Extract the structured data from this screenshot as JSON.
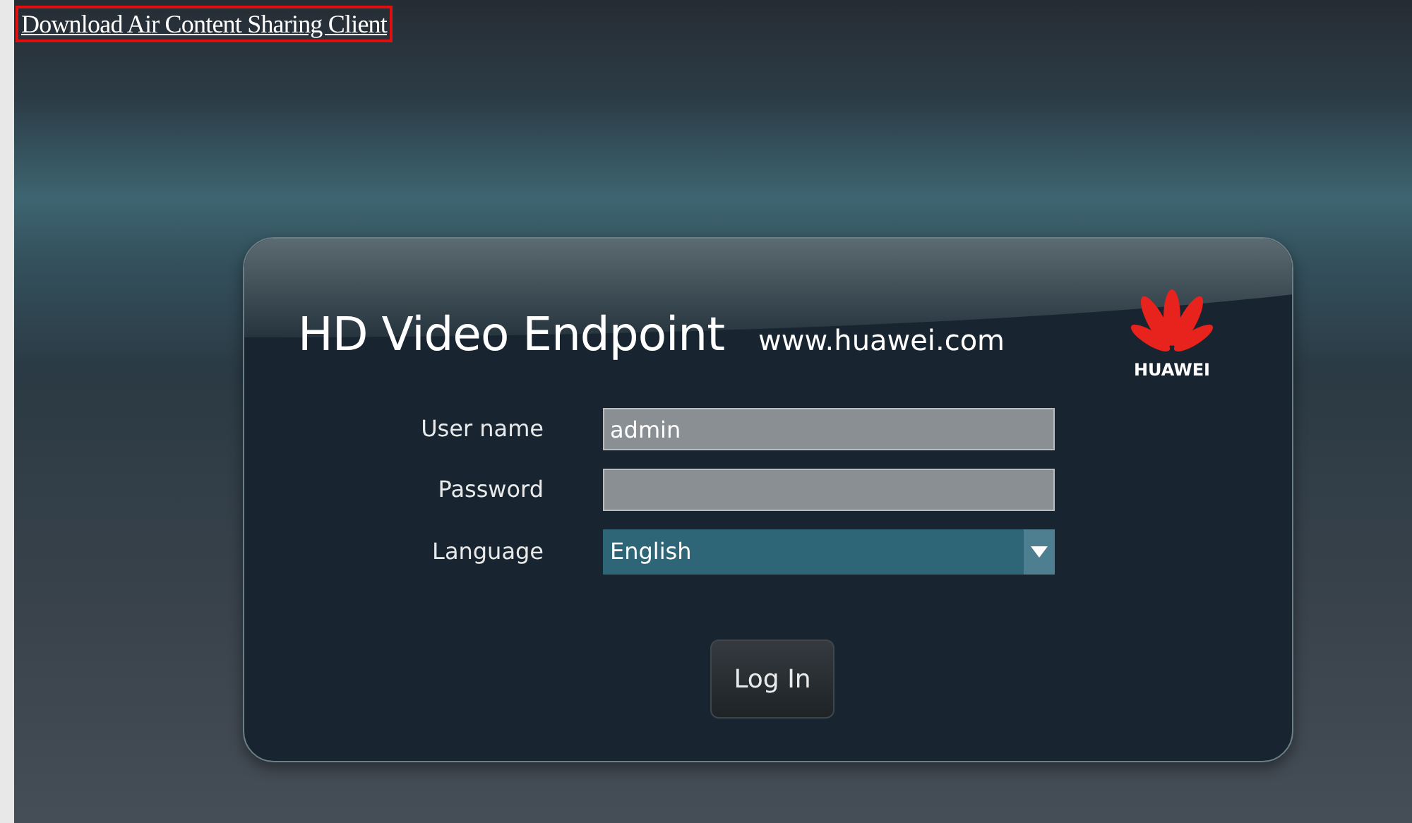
{
  "download_link": "Download Air Content Sharing Client",
  "login_card": {
    "title": "HD Video Endpoint",
    "website": "www.huawei.com",
    "logo_text": "HUAWEI",
    "fields": [
      {
        "kind": "text",
        "label": "User name",
        "value": "admin"
      },
      {
        "kind": "password",
        "label": "Password"
      },
      {
        "kind": "select",
        "label": "Language",
        "value": "English"
      }
    ],
    "button": "Log In"
  }
}
